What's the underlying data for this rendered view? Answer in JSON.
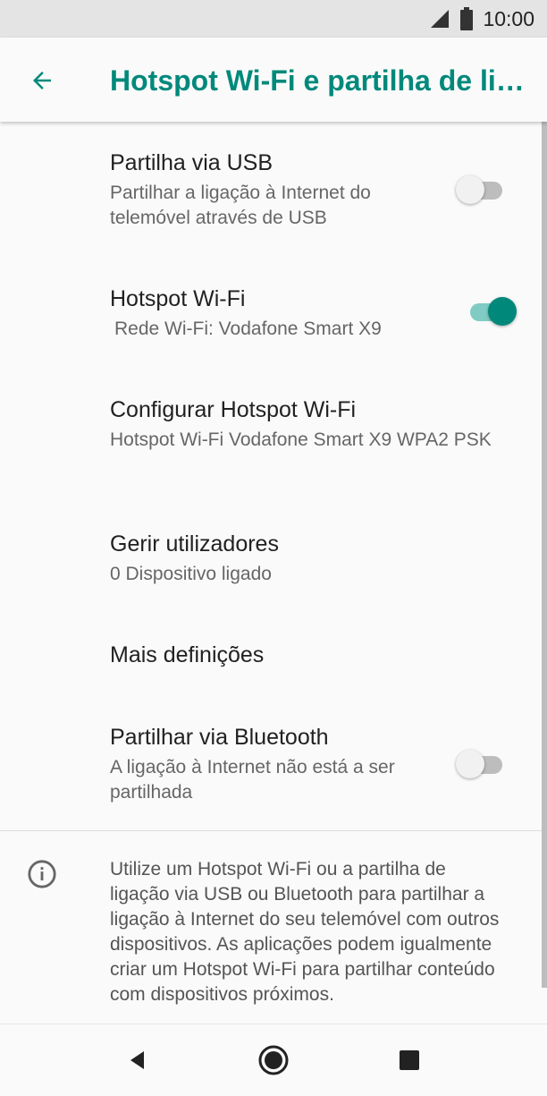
{
  "status_bar": {
    "time": "10:00",
    "icons": [
      "signal-icon",
      "battery-icon"
    ]
  },
  "app_bar": {
    "title": "Hotspot Wi-Fi e partilha de ligação",
    "back_icon": "arrow-back-icon"
  },
  "colors": {
    "accent": "#00897b",
    "accent_light": "#80cbc4",
    "toggle_off": "#bdbdbd"
  },
  "settings": [
    {
      "title": "Partilha via USB",
      "subtitle": "Partilhar a ligação à Internet do telemóvel através de USB",
      "toggle": false
    },
    {
      "title": "Hotspot Wi-Fi",
      "subtitle": "Rede Wi-Fi: Vodafone Smart X9",
      "toggle": true
    },
    {
      "title": "Configurar Hotspot Wi-Fi",
      "subtitle": "Hotspot Wi-Fi Vodafone Smart X9 WPA2 PSK"
    },
    {
      "title": "Gerir utilizadores",
      "subtitle": "0 Dispositivo ligado"
    },
    {
      "title": "Mais definições"
    },
    {
      "title": "Partilhar via Bluetooth",
      "subtitle": "A ligação à Internet não está a ser partilhada",
      "toggle": false
    }
  ],
  "info": {
    "icon": "info-icon",
    "text": "Utilize um Hotspot Wi-Fi ou a partilha de ligação via USB ou Bluetooth para partilhar a ligação à Internet do seu telemóvel com outros dispositivos. As aplicações podem igualmente criar um Hotspot Wi-Fi para partilhar conteúdo com dispositivos próximos."
  },
  "nav_bar": {
    "icons": [
      "back-triangle-icon",
      "home-circle-icon",
      "recents-square-icon"
    ]
  }
}
